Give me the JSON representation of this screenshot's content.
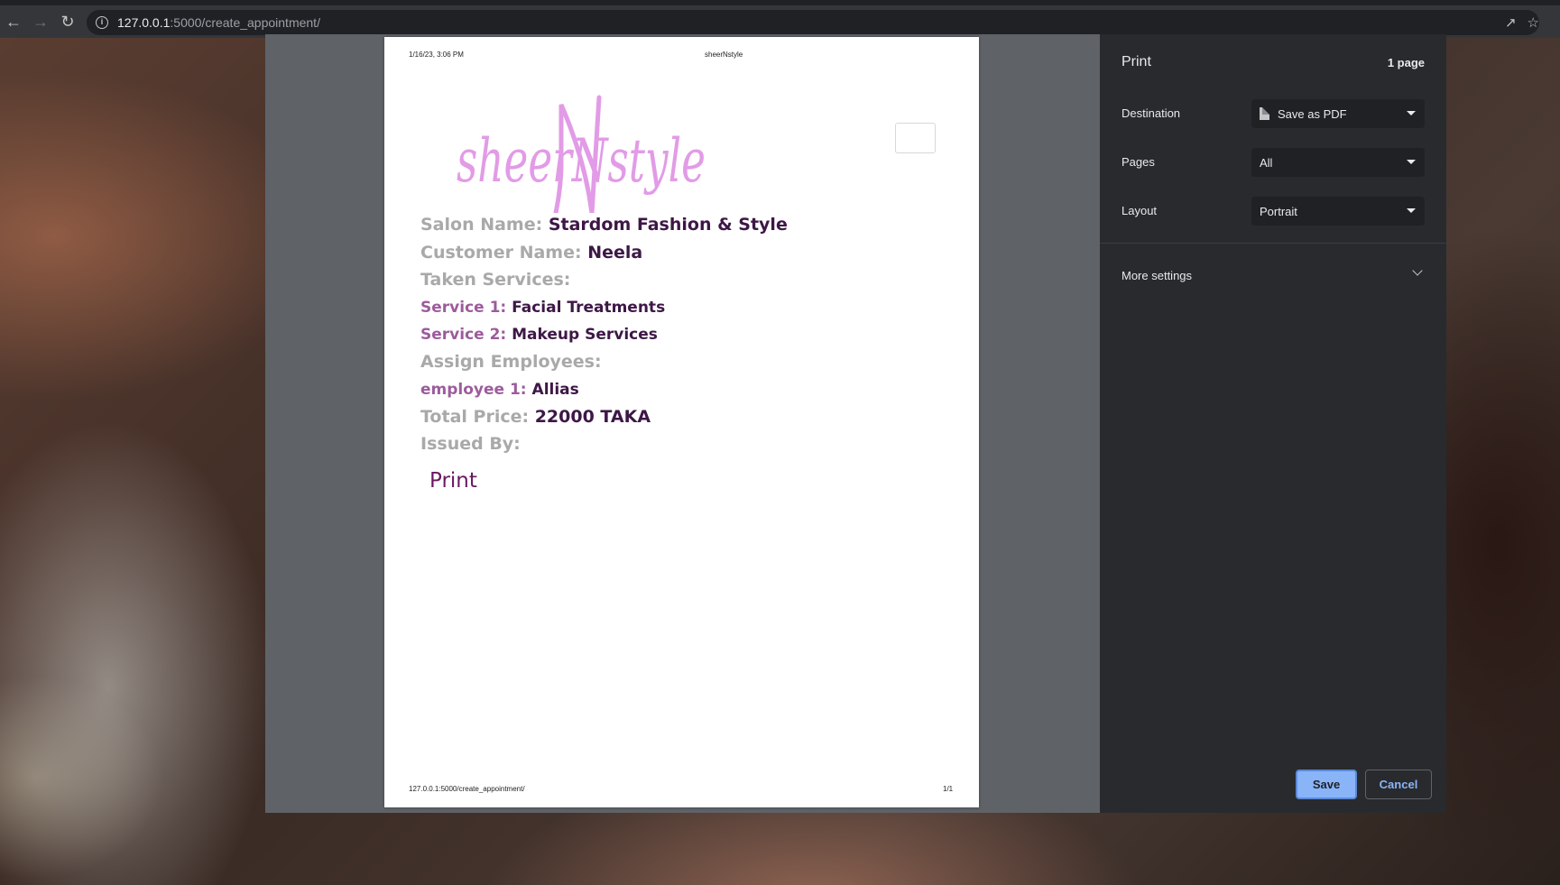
{
  "browser": {
    "url_host": "127.0.0.1",
    "url_rest": ":5000/create_appointment/"
  },
  "page_header": {
    "date": "1/16/23, 3:06 PM",
    "title": "sheerNstyle"
  },
  "page_footer": {
    "url": "127.0.0.1:5000/create_appointment/",
    "page_number": "1/1"
  },
  "logo": {
    "text": "sheerNstyle",
    "color": "#e29be6"
  },
  "receipt": {
    "salon_label": "Salon Name:",
    "salon_value": "Stardom Fashion & Style",
    "customer_label": "Customer Name:",
    "customer_value": "Neela",
    "services_label": "Taken Services:",
    "services": [
      {
        "label": "Service 1:",
        "value": "Facial Treatments"
      },
      {
        "label": "Service 2:",
        "value": "Makeup Services"
      }
    ],
    "employees_label": "Assign Employees:",
    "employees": [
      {
        "label": "employee 1:",
        "value": "Allias"
      }
    ],
    "price_label": "Total Price:",
    "price_value": "22000 TAKA",
    "issued_label": "Issued By:",
    "print_link": "Print"
  },
  "print_dialog": {
    "title": "Print",
    "page_count": "1 page",
    "destination_label": "Destination",
    "destination_value": "Save as PDF",
    "pages_label": "Pages",
    "pages_value": "All",
    "layout_label": "Layout",
    "layout_value": "Portrait",
    "more_settings": "More settings",
    "save_button": "Save",
    "cancel_button": "Cancel"
  },
  "colors": {
    "accent_blue": "#8ab4f8",
    "label_gray": "#a9a9a9",
    "value_purple": "#3d1746",
    "sub_label_purple": "#9c5c9c"
  }
}
